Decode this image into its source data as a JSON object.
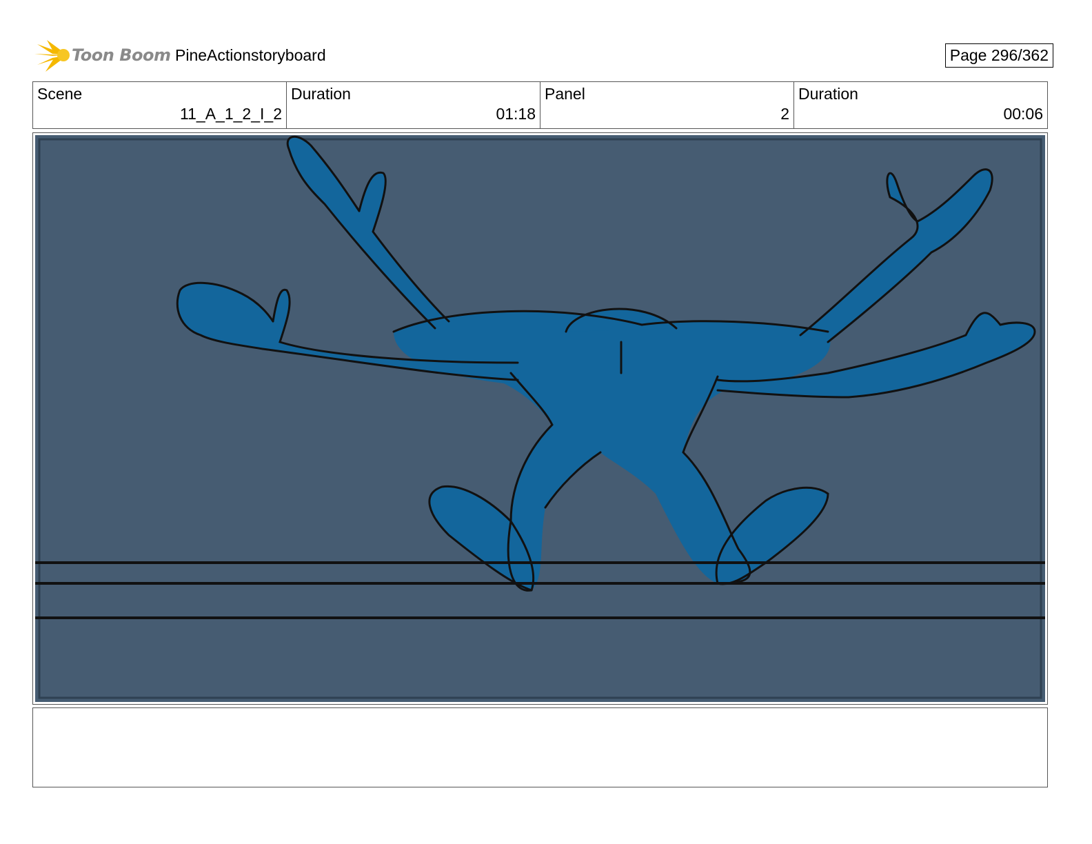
{
  "header": {
    "logo_text": "Toon Boom",
    "project_title": "PineActionstoryboard",
    "page_label": "Page 296/362"
  },
  "info": {
    "scene_label": "Scene",
    "scene_value": "11_A_1_2_I_2",
    "scene_duration_label": "Duration",
    "scene_duration_value": "01:18",
    "panel_label": "Panel",
    "panel_value": "2",
    "panel_duration_label": "Duration",
    "panel_duration_value": "00:06"
  },
  "panel": {
    "background_color": "#465c72",
    "figure_color": "#13669c",
    "line_color": "#111111"
  },
  "notes": {
    "text": ""
  }
}
